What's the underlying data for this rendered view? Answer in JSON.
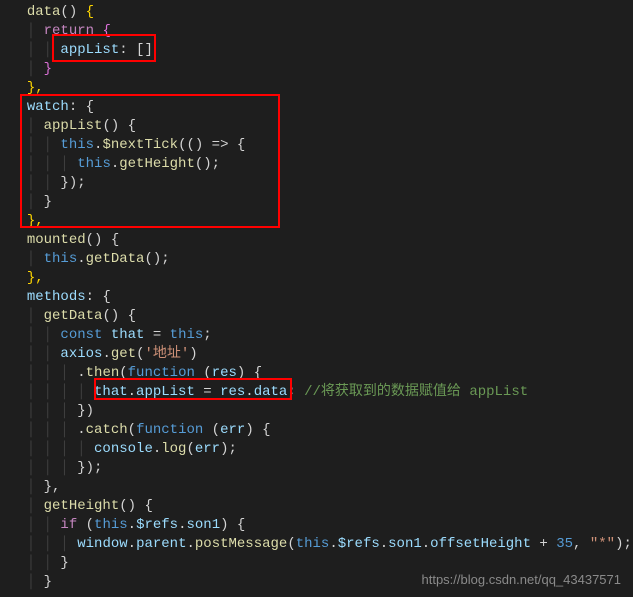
{
  "code": {
    "l1": "data",
    "l1b": "() ",
    "l1c": "{",
    "l2a": "return",
    "l2b": " {",
    "l3a": "appList",
    "l3b": ": []",
    "l4": "}",
    "l5": "},",
    "l6a": "watch",
    "l6b": ": {",
    "l7a": "appList",
    "l7b": "() {",
    "l8a": "this",
    "l8b": ".",
    "l8c": "$nextTick",
    "l8d": "(() => {",
    "l9a": "this",
    "l9b": ".",
    "l9c": "getHeight",
    "l9d": "();",
    "l10": "});",
    "l11": "}",
    "l12": "},",
    "l13a": "mounted",
    "l13b": "() {",
    "l14a": "this",
    "l14b": ".",
    "l14c": "getData",
    "l14d": "();",
    "l15": "},",
    "l16a": "methods",
    "l16b": ": {",
    "l17a": "getData",
    "l17b": "() {",
    "l18a": "const",
    "l18b": " ",
    "l18c": "that",
    "l18d": " = ",
    "l18e": "this",
    "l18f": ";",
    "l19a": "axios",
    "l19b": ".",
    "l19c": "get",
    "l19d": "(",
    "l19e": "'地址'",
    "l19f": ")",
    "l20a": ".",
    "l20b": "then",
    "l20c": "(",
    "l20d": "function",
    "l20e": " (",
    "l20f": "res",
    "l20g": ") {",
    "l21a": "that",
    "l21b": ".",
    "l21c": "appList",
    "l21d": " = ",
    "l21e": "res",
    "l21f": ".",
    "l21g": "data",
    "l21h": ";",
    "l21comment": "//将获取到的数据赋值给 appList",
    "l22": "})",
    "l23a": ".",
    "l23b": "catch",
    "l23c": "(",
    "l23d": "function",
    "l23e": " (",
    "l23f": "err",
    "l23g": ") {",
    "l24a": "console",
    "l24b": ".",
    "l24c": "log",
    "l24d": "(",
    "l24e": "err",
    "l24f": ");",
    "l25": "});",
    "l26": "},",
    "l27a": "getHeight",
    "l27b": "() {",
    "l28a": "if",
    "l28b": " (",
    "l28c": "this",
    "l28d": ".",
    "l28e": "$refs",
    "l28f": ".",
    "l28g": "son1",
    "l28h": ") {",
    "l29a": "window",
    "l29b": ".",
    "l29c": "parent",
    "l29d": ".",
    "l29e": "postMessage",
    "l29f": "(",
    "l29g": "this",
    "l29h": ".",
    "l29i": "$refs",
    "l29j": ".",
    "l29k": "son1",
    "l29l": ".",
    "l29m": "offsetHeight",
    "l29n": " + ",
    "l29o": "35",
    "l29p": ", ",
    "l29q": "\"*\"",
    "l29r": ");",
    "l30": "}",
    "l31": "}"
  },
  "watermark": "https://blog.csdn.net/qq_43437571"
}
